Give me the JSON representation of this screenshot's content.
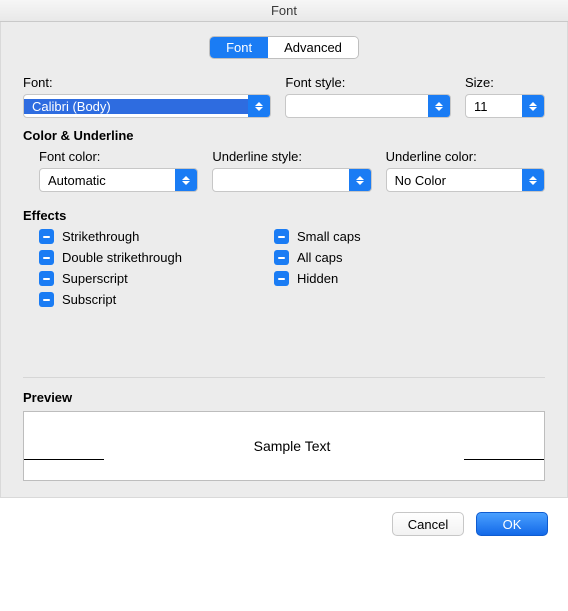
{
  "window_title": "Font",
  "tabs": {
    "font": "Font",
    "advanced": "Advanced"
  },
  "font_section": {
    "font_label": "Font:",
    "font_value": "Calibri (Body)",
    "style_label": "Font style:",
    "style_value": "",
    "size_label": "Size:",
    "size_value": "11"
  },
  "color_section": {
    "title": "Color & Underline",
    "font_color_label": "Font color:",
    "font_color_value": "Automatic",
    "underline_style_label": "Underline style:",
    "underline_style_value": "",
    "underline_color_label": "Underline color:",
    "underline_color_value": "No Color"
  },
  "effects": {
    "title": "Effects",
    "left": [
      "Strikethrough",
      "Double strikethrough",
      "Superscript",
      "Subscript"
    ],
    "right": [
      "Small caps",
      "All caps",
      "Hidden"
    ]
  },
  "preview": {
    "title": "Preview",
    "sample": "Sample Text"
  },
  "buttons": {
    "cancel": "Cancel",
    "ok": "OK"
  }
}
